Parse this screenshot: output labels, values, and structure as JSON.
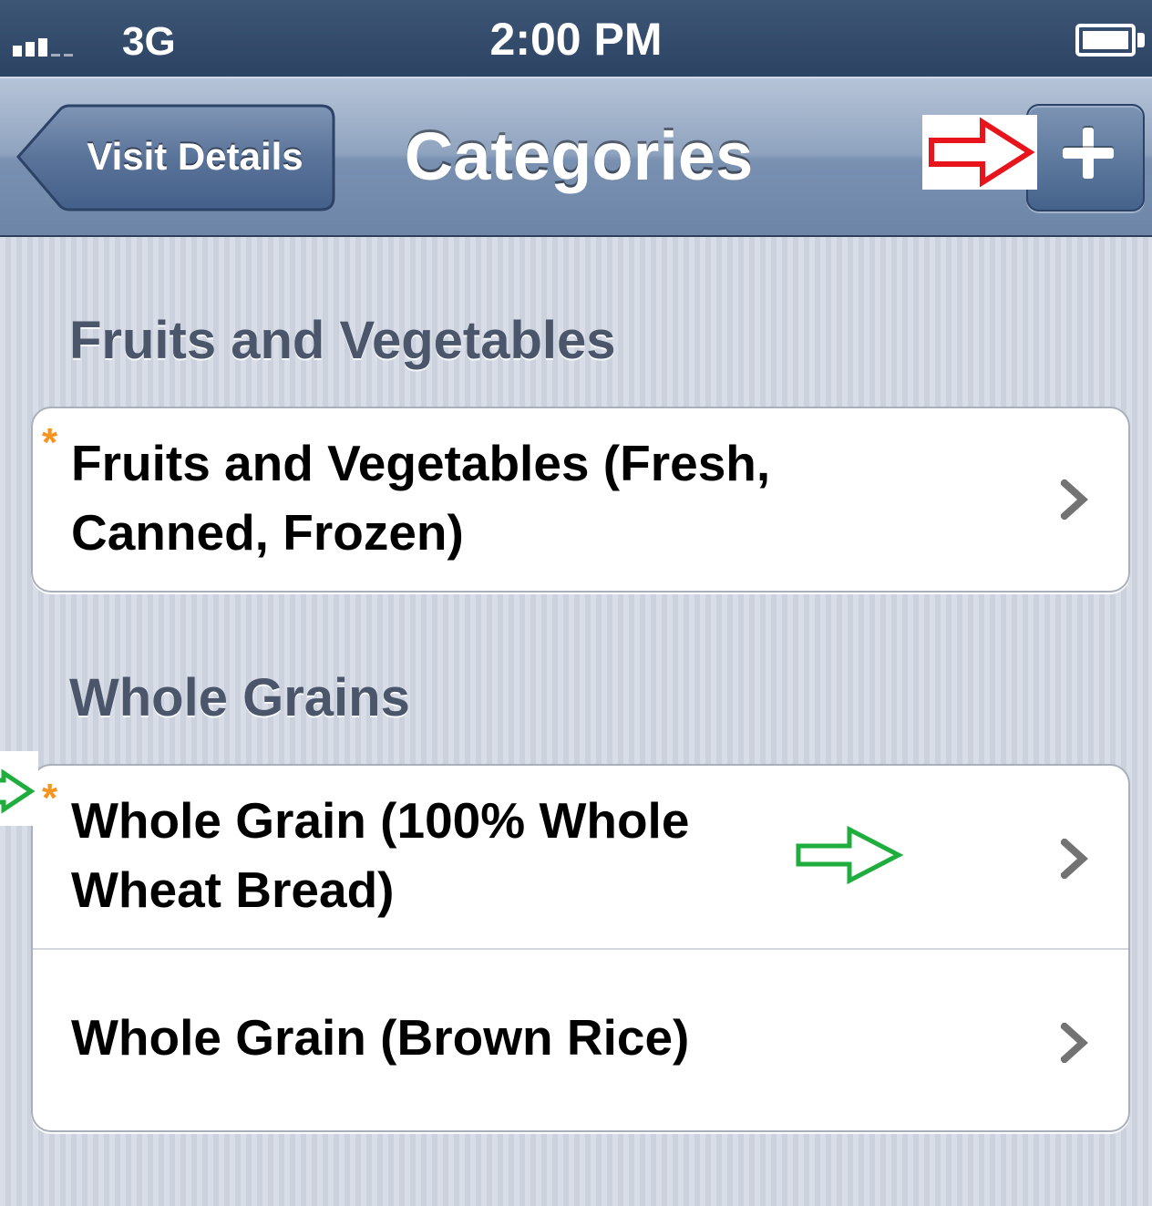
{
  "status_bar": {
    "network": "3G",
    "time": "2:00 PM"
  },
  "nav_bar": {
    "back_label": "Visit Details",
    "title": "Categories",
    "add_icon": "plus-icon"
  },
  "sections": [
    {
      "header": "Fruits and Vegetables",
      "rows": [
        {
          "label": "Fruits and Vegetables (Fresh,\nCanned, Frozen)",
          "required_mark": "*",
          "accessory": "chevron-right-icon"
        }
      ]
    },
    {
      "header": "Whole Grains",
      "rows": [
        {
          "label": "Whole Grain (100% Whole\nWheat Bread)",
          "required_mark": "*",
          "accessory": "chevron-right-icon"
        },
        {
          "label": "Whole Grain (Brown Rice)",
          "accessory": "chevron-right-icon"
        }
      ]
    }
  ],
  "colors": {
    "required_mark": "#f7941d",
    "annotation_red": "#e8141b",
    "annotation_green": "#1fae3e",
    "section_header": "#4c566a",
    "nav_bar": "#6d86a8"
  }
}
